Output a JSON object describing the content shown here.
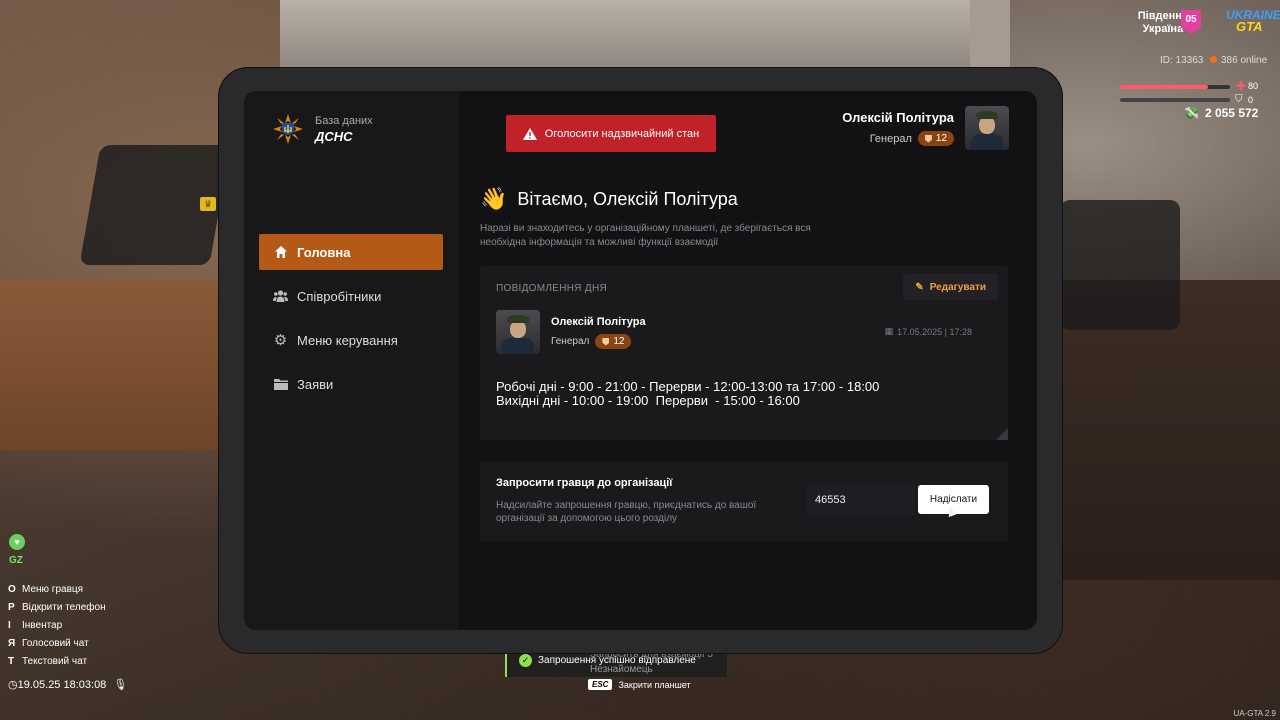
{
  "hud": {
    "region_line1": "Південна",
    "region_line2": "Україна",
    "region_badge": "05",
    "logo_line1": "UKRAINE",
    "logo_line2": "GTA",
    "player_id": "ID: 13363",
    "online": "386 online",
    "health": "80",
    "health_level": 0.8,
    "armor": "0",
    "armor_level": 0,
    "money": "2 055 572",
    "gz_label": "GZ",
    "keys": [
      {
        "key": "O",
        "label": "Меню гравця"
      },
      {
        "key": "P",
        "label": "Відкрити телефон"
      },
      {
        "key": "I",
        "label": "Інвентар"
      },
      {
        "key": "Я",
        "label": "Голосовий чат"
      },
      {
        "key": "T",
        "label": "Текстовий чат"
      }
    ],
    "datetime": "19.05.25 18:03:08",
    "version": "UA-GTA 2.9"
  },
  "notifications": {
    "ghost_text": "Запросить для взаємодії 3",
    "ghost_text2": "Незнайомець",
    "main_text": "Запрошення успішно відправлене",
    "esc_key": "ESC",
    "esc_label": "Закрити планшет"
  },
  "tablet": {
    "logo_sub": "База даних",
    "logo_main": "ДСНС",
    "nav": [
      {
        "label": "Головна",
        "icon": "home-icon",
        "active": true
      },
      {
        "label": "Співробітники",
        "icon": "people-icon",
        "active": false
      },
      {
        "label": "Меню керування",
        "icon": "gear-icon",
        "active": false
      },
      {
        "label": "Заяви",
        "icon": "folder-icon",
        "active": false
      }
    ],
    "alarm_label": "Оголосити надзвичайний стан",
    "user": {
      "name": "Олексій Політура",
      "rank": "Генерал",
      "level": "12"
    },
    "greeting": "Вітаємо, Олексій Політура",
    "greeting_desc": "Наразі ви знаходитесь у організаційному планшеті, де зберігається вся необхідна інформація та можливі функції взаємодії",
    "motd": {
      "title": "ПОВІДОМЛЕННЯ ДНЯ",
      "edit_label": "Редагувати",
      "author": "Олексій Політура",
      "rank": "Генерал",
      "level": "12",
      "date": "17.05.2025 | 17:28",
      "text": "Робочі дні - 9:00 - 21:00 - Перерви - 12:00-13:00 та 17:00 - 18:00\nВихідні дні - 10:00 - 19:00  Перерви  - 15:00 - 16:00"
    },
    "invite": {
      "title": "Запросити гравця до організації",
      "desc": "Надсилайте запрошення гравцю, приєднатись до вашої організації за допомогою цього розділу",
      "input_value": "46553",
      "send_label": "Надіслати"
    }
  },
  "colors": {
    "accent": "#b55a16",
    "danger": "#c0222a",
    "success": "#8fe04a"
  }
}
